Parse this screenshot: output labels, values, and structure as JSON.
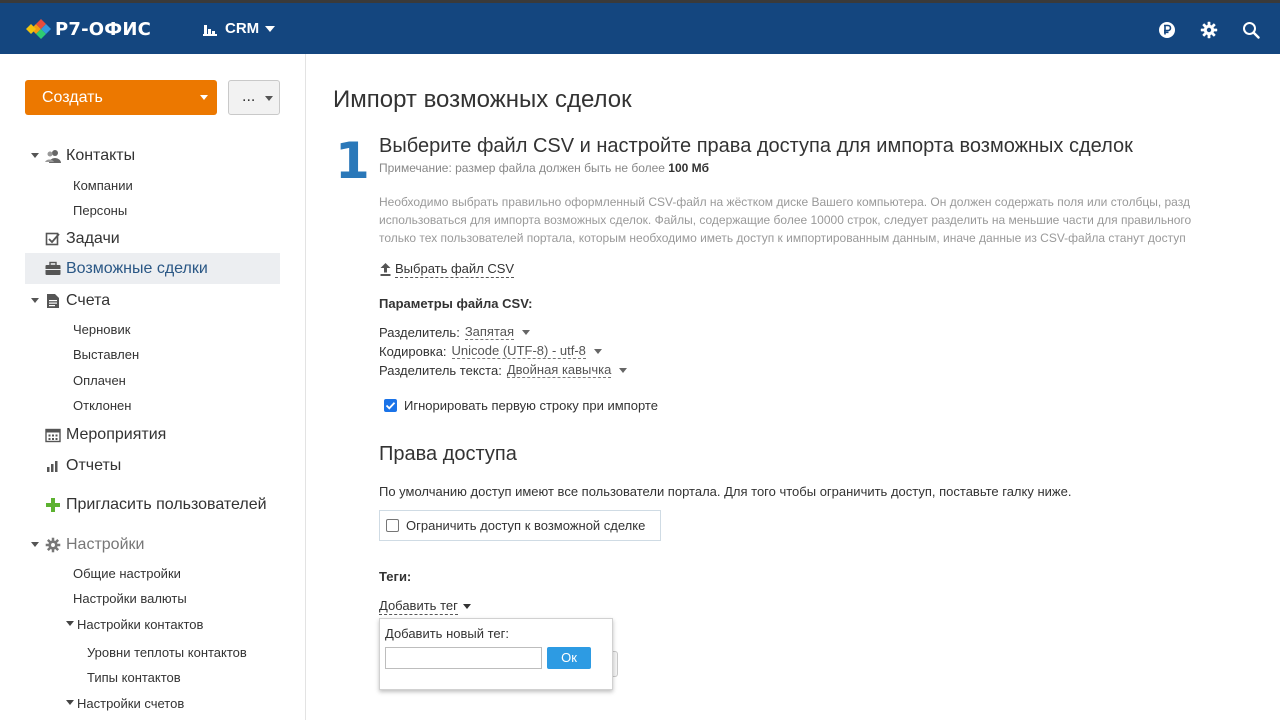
{
  "header": {
    "logo_text": "Р7-ОФИС",
    "module_label": "CRM",
    "colors": {
      "bar": "#14467f",
      "accent": "#ec7800",
      "link": "#2a5785",
      "step": "#2a78b9",
      "ok": "#2d9be3"
    }
  },
  "sidebar": {
    "create_label": "Создать",
    "more_label": "...",
    "items": {
      "contacts": "Контакты",
      "companies": "Компании",
      "persons": "Персоны",
      "tasks": "Задачи",
      "deals": "Возможные сделки",
      "invoices": "Счета",
      "draft": "Черновик",
      "issued": "Выставлен",
      "paid": "Оплачен",
      "rejected": "Отклонен",
      "events": "Мероприятия",
      "reports": "Отчеты",
      "invite": "Пригласить пользователей",
      "settings": "Настройки",
      "general_settings": "Общие настройки",
      "currency_settings": "Настройки валюты",
      "contact_settings": "Настройки контактов",
      "temperature_levels": "Уровни теплоты контактов",
      "contact_types": "Типы контактов",
      "invoice_settings": "Настройки счетов"
    }
  },
  "main": {
    "page_title": "Импорт возможных сделок",
    "step_number": "1",
    "step_title": "Выберите файл CSV и настройте права доступа для импорта возможных сделок",
    "note_prefix": "Примечание: размер файла должен быть не более ",
    "note_bold": "100 Мб",
    "desc_lines": [
      "Необходимо выбрать правильно оформленный CSV-файл на жёстком диске Вашего компьютера. Он должен содержать поля или столбцы, разд",
      "использоваться для импорта возможных сделок. Файлы, содержащие более 10000 строк, следует разделить на меньшие части для правильного",
      "только тех пользователей портала, которым необходимо иметь доступ к импортированным данным, иначе данные из CSV-файла станут доступ"
    ],
    "choose_file": "Выбрать файл CSV",
    "params_title": "Параметры файла CSV:",
    "separator_label": "Разделитель:",
    "separator_value": "Запятая",
    "encoding_label": "Кодировка:",
    "encoding_value": "Unicode (UTF-8) - utf-8",
    "text_separator_label": "Разделитель текста:",
    "text_separator_value": "Двойная кавычка",
    "ignore_first_row": "Игнорировать первую строку при импорте",
    "ignore_first_row_checked": true,
    "access_title": "Права доступа",
    "access_desc": "По умолчанию доступ имеют все пользователи портала. Для того чтобы ограничить доступ, поставьте галку ниже.",
    "restrict_label": "Ограничить доступ к возможной сделке",
    "restrict_checked": false,
    "tags_title": "Теги:",
    "add_tag": "Добавить тег",
    "tag_popup": {
      "label": "Добавить новый тег:",
      "input_value": "",
      "ok_label": "Ок"
    }
  }
}
